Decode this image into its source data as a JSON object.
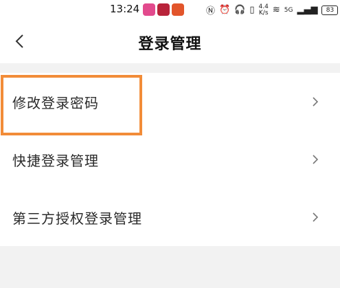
{
  "status_bar": {
    "time": "13:24",
    "net_speed_value": "4.4",
    "net_speed_unit": "K/s",
    "network_type": "5G",
    "battery": "83"
  },
  "header": {
    "title": "登录管理"
  },
  "menu": {
    "items": [
      {
        "label": "修改登录密码"
      },
      {
        "label": "快捷登录管理"
      },
      {
        "label": "第三方授权登录管理"
      }
    ]
  },
  "colors": {
    "highlight": "#f28c38",
    "background": "#f2f2f2",
    "surface": "#ffffff"
  },
  "icons": {
    "back": "chevron-left-icon",
    "row_arrow": "chevron-right-icon"
  }
}
